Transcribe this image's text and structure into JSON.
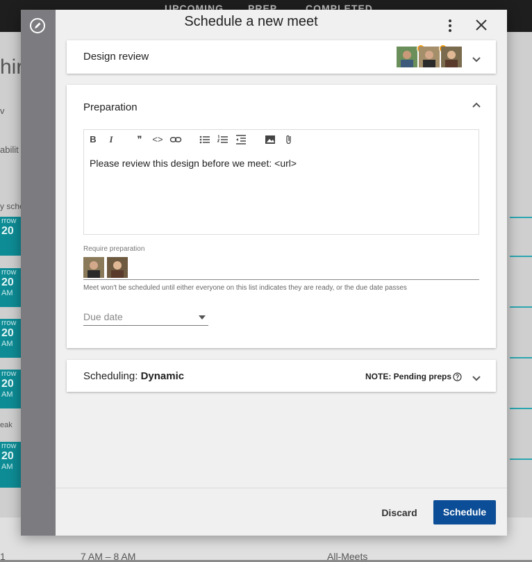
{
  "background": {
    "tabs": [
      "UPCOMING",
      "PREP",
      "COMPLETED"
    ],
    "left_fragments": [
      "hir",
      "v",
      "abilit",
      "y sche",
      "eak"
    ],
    "cards": [
      {
        "line1": "rrow",
        "line2": "20",
        "line3": ""
      },
      {
        "line1": "rrow",
        "line2": "20",
        "line3": "AM"
      },
      {
        "line1": "rrow",
        "line2": "20",
        "line3": "AM"
      },
      {
        "line1": "rrow",
        "line2": "20",
        "line3": "AM"
      },
      {
        "line1": "rrow",
        "line2": "20",
        "line3": "AM"
      }
    ],
    "bottom": {
      "num": "1",
      "time": "7 AM – 8 AM",
      "label": "All-Meets"
    }
  },
  "dialog": {
    "title": "Schedule a new meet",
    "rail_icon": "edit-icon",
    "menu_icon": "more-vert-icon",
    "close_icon": "close-icon"
  },
  "meeting": {
    "name": "Design review",
    "attendee_count": 3,
    "attendee_badges": [
      true,
      true,
      false
    ]
  },
  "preparation": {
    "heading": "Preparation",
    "toolbar": {
      "bold": "B",
      "italic": "I",
      "quote": "❞",
      "code": "<>",
      "link": "link-icon",
      "bullets": "bulleted-list-icon",
      "numbers": "numbered-list-icon",
      "indent": "indent-icon",
      "image": "image-icon",
      "attach": "attach-icon"
    },
    "body_text": "Please review this design before we meet: <url>",
    "require_label": "Require preparation",
    "required_people_count": 2,
    "hint": "Meet won't be scheduled until either everyone on this list indicates they are ready, or the due date passes",
    "due_date_placeholder": "Due date"
  },
  "scheduling": {
    "label": "Scheduling: ",
    "mode": "Dynamic",
    "note": "NOTE: Pending preps",
    "help_icon": "help-circle-icon"
  },
  "actions": {
    "discard": "Discard",
    "schedule": "Schedule"
  },
  "colors": {
    "primary": "#0b4d96",
    "badge": "#f39c12",
    "teal": "#0e8c95"
  }
}
